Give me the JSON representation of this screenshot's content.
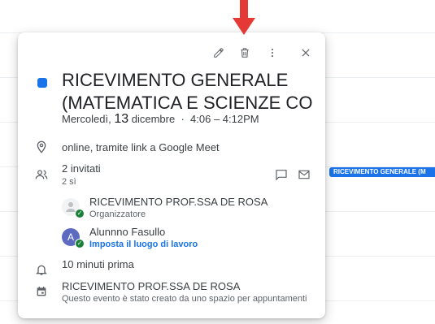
{
  "calendar_chip": {
    "label": "RICEVIMENTO GENERALE (M"
  },
  "toolbar": {
    "edit_icon": "pencil-icon",
    "delete_icon": "trash-icon",
    "more_icon": "more-vert-icon",
    "close_icon": "close-icon"
  },
  "event": {
    "color": "#1a73e8",
    "title_line1": "RICEVIMENTO GENERALE",
    "title_line2": "(MATEMATICA E SCIENZE CORSO...",
    "date_prefix": "Mercoledì,",
    "date_day": "13",
    "date_suffix": "dicembre",
    "separator": "·",
    "time": "4:06 – 4:12PM"
  },
  "location": {
    "text": "online, tramite link a Google Meet"
  },
  "guests": {
    "count_label": "2 invitati",
    "yes_label": "2 sì",
    "list": [
      {
        "name": "RICEVIMENTO PROF.SSA DE ROSA",
        "role": "Organizzatore",
        "avatar_letter": ""
      },
      {
        "name": "Alunnno Fasullo",
        "role": "Imposta il luogo di lavoro",
        "avatar_letter": "A"
      }
    ]
  },
  "reminder": {
    "text": "10 minuti prima"
  },
  "calendar": {
    "name": "RICEVIMENTO PROF.SSA DE ROSA",
    "note": "Questo evento è stato creato da uno spazio per appuntamenti"
  }
}
